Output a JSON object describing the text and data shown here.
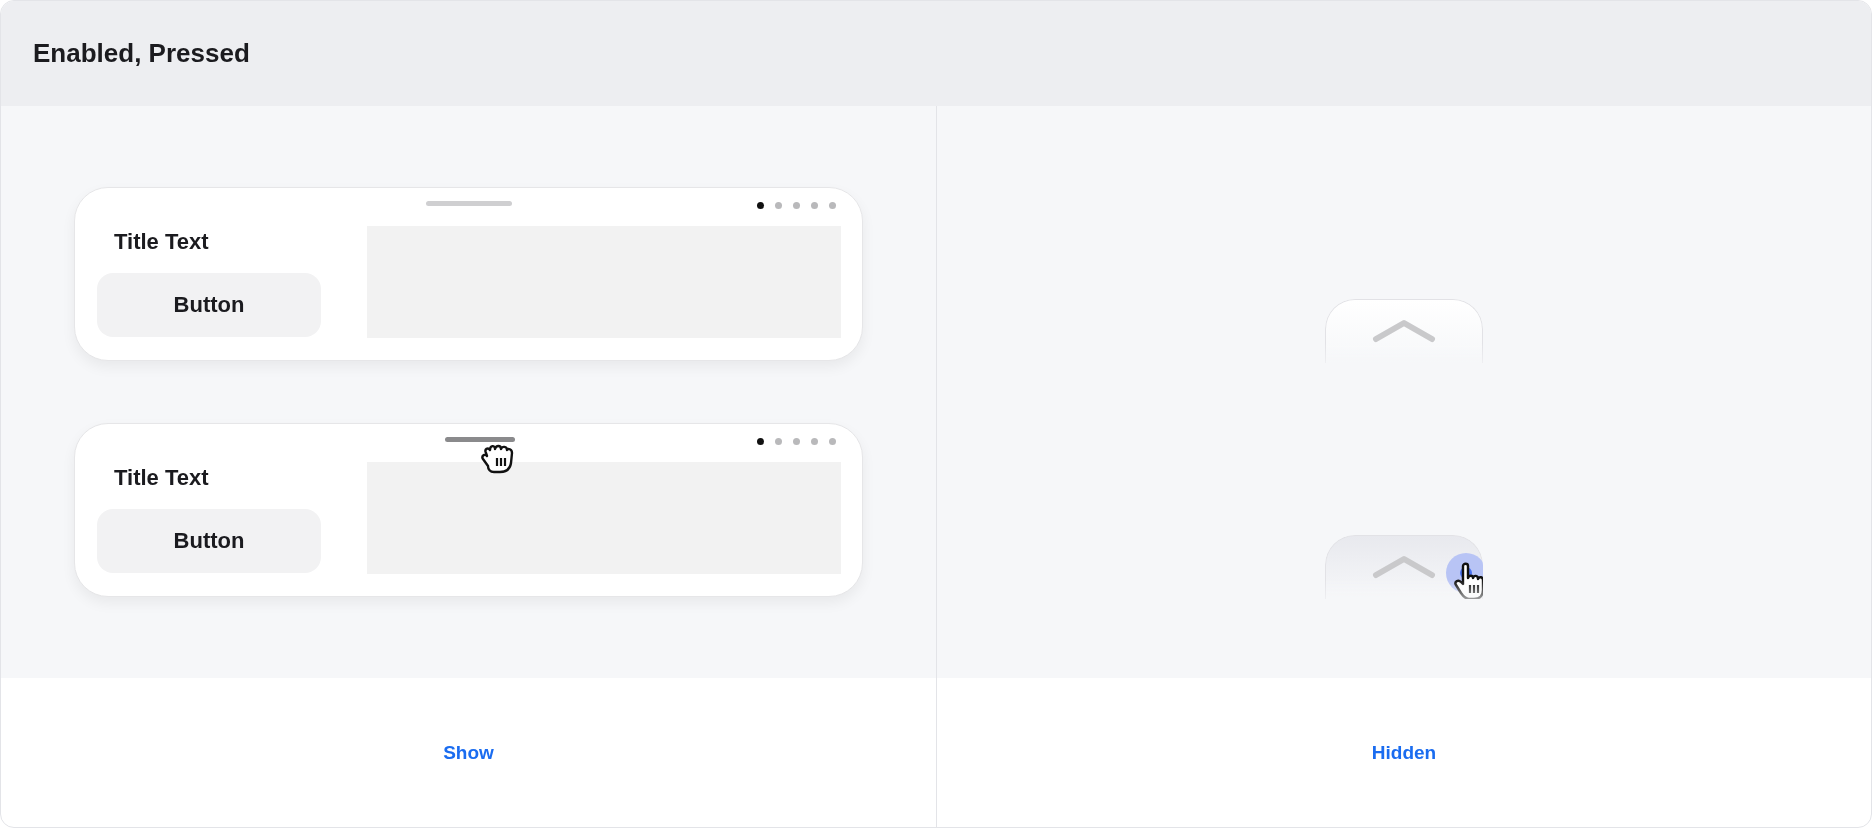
{
  "header": {
    "title": "Enabled, Pressed"
  },
  "panels": [
    {
      "kind": "cards",
      "caption": "Show",
      "cards": [
        {
          "title": "Title Text",
          "button": "Button",
          "handle_pressed": false,
          "dots": [
            {
              "selected": true
            },
            {
              "selected": false
            },
            {
              "selected": false
            },
            {
              "selected": false
            },
            {
              "selected": false
            }
          ]
        },
        {
          "title": "Title Text",
          "button": "Button",
          "handle_pressed": true,
          "dots": [
            {
              "selected": true
            },
            {
              "selected": false
            },
            {
              "selected": false
            },
            {
              "selected": false
            },
            {
              "selected": false
            }
          ]
        }
      ]
    },
    {
      "kind": "tabs",
      "caption": "Hidden",
      "tabs": [
        {
          "pressed": false
        },
        {
          "pressed": true
        }
      ]
    }
  ]
}
